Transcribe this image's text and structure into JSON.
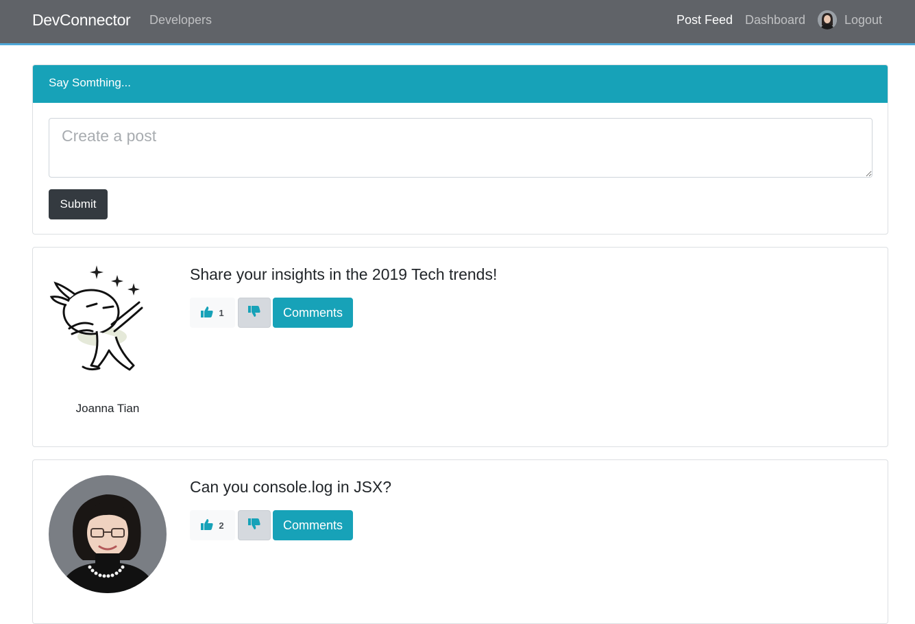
{
  "navbar": {
    "brand": "DevConnector",
    "developers": "Developers",
    "post_feed": "Post Feed",
    "dashboard": "Dashboard",
    "logout": "Logout"
  },
  "post_form": {
    "header": "Say Somthing...",
    "placeholder": "Create a post",
    "value": "",
    "submit_label": "Submit"
  },
  "posts": [
    {
      "text": "Share your insights in the 2019 Tech trends!",
      "author": "Joanna Tian",
      "avatar": "cartoon-rabbit-dab",
      "likes": "1",
      "comments_label": "Comments"
    },
    {
      "text": "Can you console.log in JSX?",
      "author": "",
      "avatar": "woman-portrait",
      "likes": "2",
      "comments_label": "Comments"
    }
  ],
  "colors": {
    "navbar_bg": "#606368",
    "navbar_border": "#4fa8d8",
    "accent": "#17a2b8",
    "dark_button": "#343a40"
  }
}
